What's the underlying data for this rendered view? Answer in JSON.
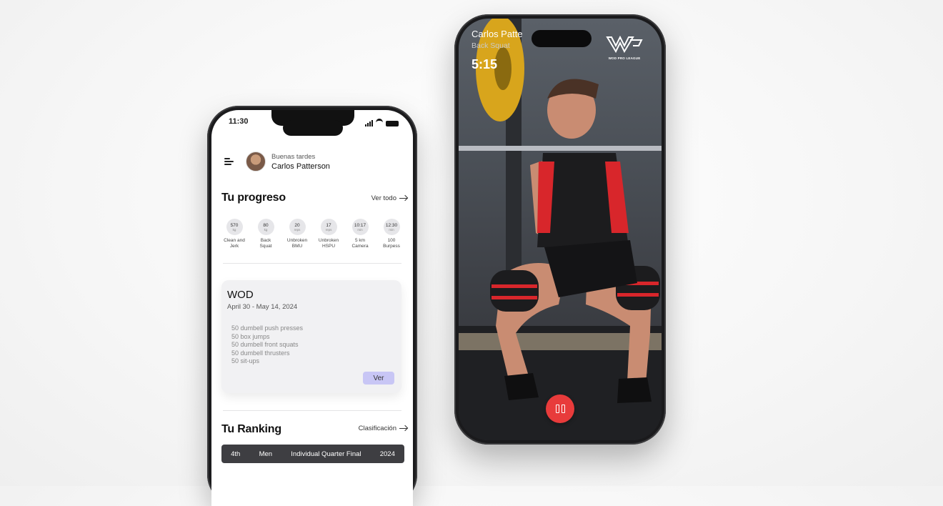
{
  "left_phone": {
    "status": {
      "time": "11:30"
    },
    "header": {
      "greeting": "Buenas tardes",
      "user_name": "Carlos Patterson"
    },
    "progress": {
      "title": "Tu progreso",
      "see_all": "Ver todo",
      "items": [
        {
          "value": "570",
          "unit": "kg",
          "label_1": "Clean and",
          "label_2": "Jerk"
        },
        {
          "value": "80",
          "unit": "kg",
          "label_1": "Back",
          "label_2": "Squat"
        },
        {
          "value": "20",
          "unit": "reps",
          "label_1": "Unbroken",
          "label_2": "BMU"
        },
        {
          "value": "17",
          "unit": "reps",
          "label_1": "Unbroken",
          "label_2": "HSPU"
        },
        {
          "value": "10:17",
          "unit": "min",
          "label_1": "5 km",
          "label_2": "Camera"
        },
        {
          "value": "12:30",
          "unit": "min",
          "label_1": "100",
          "label_2": "Burpess"
        }
      ]
    },
    "wod": {
      "title": "WOD",
      "date_range": "April 30 - May 14, 2024",
      "exercises": [
        "50 dumbell push presses",
        "50 box jumps",
        "50 dumbell front squats",
        "50 dumbell thrusters",
        "50 sit-ups"
      ],
      "button_label": "Ver"
    },
    "ranking": {
      "title": "Tu Ranking",
      "link": "Clasificación",
      "position": "4th",
      "category": "Men",
      "competition": "Individual Quarter Final",
      "year": "2024"
    }
  },
  "right_phone": {
    "athlete_name": "Carlos Patte",
    "exercise": "Back Squat",
    "timer": "5:15",
    "logo_text": "WOD PRO LEAGUE",
    "colors": {
      "record": "#e83b3b",
      "singlet_red": "#d8262b"
    }
  }
}
